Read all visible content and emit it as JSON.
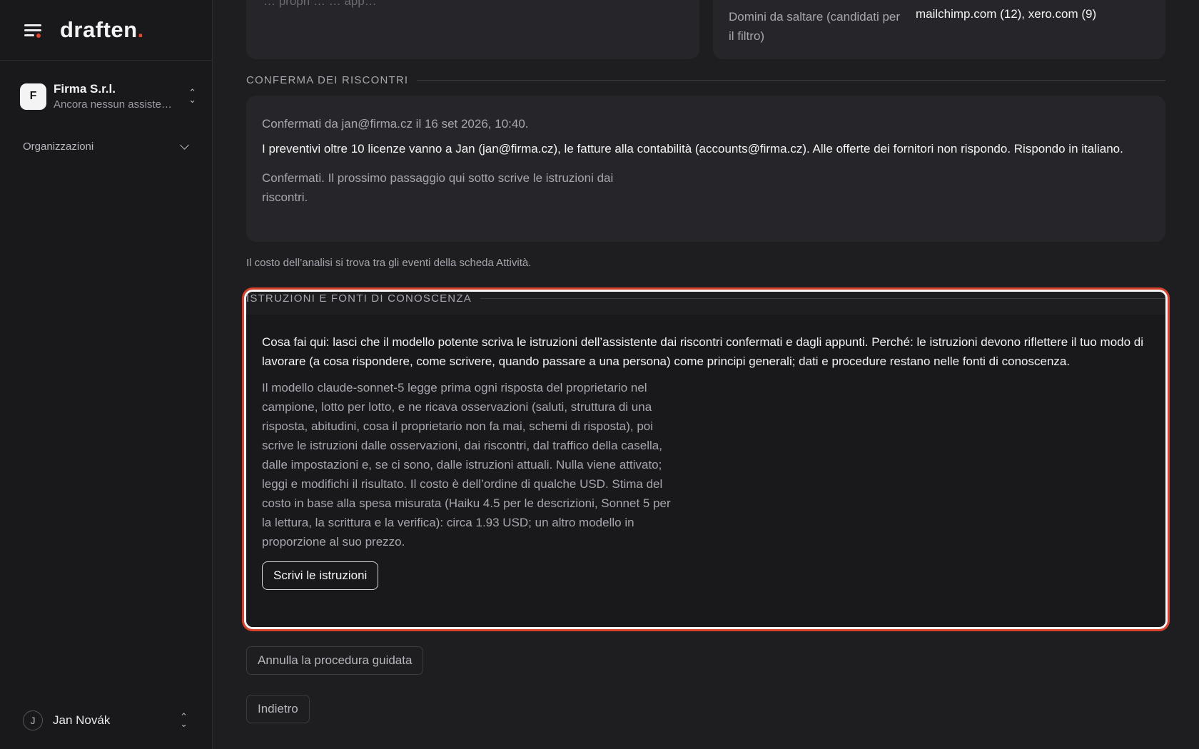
{
  "sidebar": {
    "logo": "draften",
    "logo_dot": ".",
    "org": {
      "initial": "F",
      "name": "Firma S.r.l.",
      "subtitle": "Ancora nessun assistente"
    },
    "section": "Organizzazioni",
    "user": {
      "initial": "J",
      "name": "Jan Novák"
    }
  },
  "top": {
    "left_faint": "…  propri  …  …  app…",
    "domains_label": "Domini da saltare (candidati per il filtro)",
    "domains_value": "mailchimp.com (12), xero.com (9)"
  },
  "confirm": {
    "title": "Conferma dei riscontri",
    "meta": "Confermati da jan@firma.cz il 16 set 2026, 10:40.",
    "body": "I preventivi oltre 10 licenze vanno a Jan (jan@firma.cz), le fatture alla contabilità (accounts@firma.cz). Alle offerte dei fornitori non rispondo. Rispondo in italiano.",
    "next": "Confermati. Il prossimo passaggio qui sotto scrive le istruzioni dai riscontri."
  },
  "cost_note": "Il costo dell’analisi si trova tra gli eventi della scheda Attività.",
  "instructions": {
    "title": "Istruzioni e fonti di conoscenza",
    "intro": "Cosa fai qui: lasci che il modello potente scriva le istruzioni dell’assistente dai riscontri confermati e dagli appunti. Perché: le istruzioni devono riflettere il tuo modo di lavorare (a cosa rispondere, come scrivere, quando passare a una persona) come principi generali; dati e procedure restano nelle fonti di conoscenza.",
    "details": "Il modello claude-sonnet-5 legge prima ogni risposta del proprietario nel campione, lotto per lotto, e ne ricava osservazioni (saluti, struttura di una risposta, abitudini, cosa il proprietario non fa mai, schemi di risposta), poi scrive le istruzioni dalle osservazioni, dai riscontri, dal traffico della casella, dalle impostazioni e, se ci sono, dalle istruzioni attuali. Nulla viene attivato; leggi e modifichi il risultato. Il costo è dell’ordine di qualche USD. Stima del costo in base alla spesa misurata (Haiku 4.5 per le descrizioni, Sonnet 5 per la lettura, la scrittura e la verifica): circa 1.93 USD; un altro modello in proporzione al suo prezzo.",
    "button": "Scrivi le istruzioni"
  },
  "actions": {
    "cancel": "Annulla la procedura guidata",
    "back": "Indietro"
  }
}
